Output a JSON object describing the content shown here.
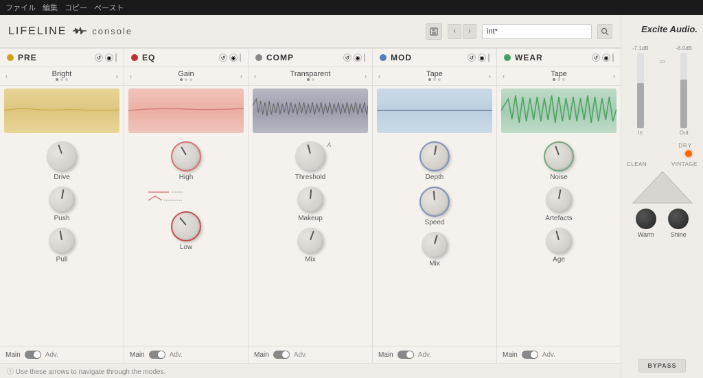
{
  "titleBar": {
    "items": [
      "ファイル",
      "編集",
      "コピー",
      "ペースト"
    ]
  },
  "topBar": {
    "logo": "LIFELINE",
    "subLogo": "console",
    "presetName": "int*",
    "presetPlaceholder": "int*"
  },
  "modules": [
    {
      "id": "pre",
      "title": "PRE",
      "dotColor": "#d4a020",
      "mode": "Bright",
      "waveformClass": "waveform-pre",
      "knobs": [
        {
          "label": "Drive",
          "rotation": -20
        },
        {
          "label": "Push",
          "rotation": 10
        },
        {
          "label": "Pull",
          "rotation": -10
        }
      ],
      "footer": {
        "main": "Main",
        "adv": "Adv."
      }
    },
    {
      "id": "eq",
      "title": "EQ",
      "dotColor": "#c03030",
      "mode": "Gain",
      "waveformClass": "waveform-eq",
      "knobs": [
        {
          "label": "High",
          "rotation": -30,
          "ring": "red"
        },
        {
          "label": "",
          "rotation": 0,
          "special": "eq-lines"
        },
        {
          "label": "Low",
          "rotation": -40,
          "ring": "red"
        }
      ],
      "footer": {
        "main": "Main",
        "adv": "Adv."
      }
    },
    {
      "id": "comp",
      "title": "COMP",
      "dotColor": "#888888",
      "mode": "Transparent",
      "waveformClass": "waveform-comp",
      "knobs": [
        {
          "label": "Threshold",
          "rotation": -15
        },
        {
          "label": "Makeup",
          "rotation": 5
        },
        {
          "label": "Mix",
          "rotation": 20
        }
      ],
      "footer": {
        "main": "Main",
        "adv": "Adv."
      }
    },
    {
      "id": "mod",
      "title": "MOD",
      "dotColor": "#5080c0",
      "mode": "Tape",
      "waveformClass": "waveform-mod",
      "knobs": [
        {
          "label": "Depth",
          "rotation": 10
        },
        {
          "label": "Speed",
          "rotation": -5
        },
        {
          "label": "Mix",
          "rotation": 15
        }
      ],
      "footer": {
        "main": "Main",
        "adv": "Adv."
      }
    },
    {
      "id": "wear",
      "title": "WEAR",
      "dotColor": "#40a060",
      "mode": "Tape",
      "waveformClass": "waveform-wear",
      "knobs": [
        {
          "label": "Noise",
          "rotation": -20,
          "ring": "green"
        },
        {
          "label": "Artefacts",
          "rotation": 10
        },
        {
          "label": "Age",
          "rotation": -15
        }
      ],
      "footer": {
        "main": "Main",
        "adv": "Adv."
      }
    }
  ],
  "rightPanel": {
    "title": "Excite Audio.",
    "inLabel": "In",
    "outLabel": "Out",
    "inValue": "-7.1dB",
    "outValue": "-6.0dB",
    "dryLabel": "DRY",
    "cleanLabel": "CLEAN",
    "vintageLabel": "VINTAGE",
    "warmLabel": "Warm",
    "shineLabel": "Shine",
    "bypassLabel": "BYPASS"
  },
  "bottomInfo": {
    "text": "ⓘ  Use these arrows to navigate through the modes."
  }
}
